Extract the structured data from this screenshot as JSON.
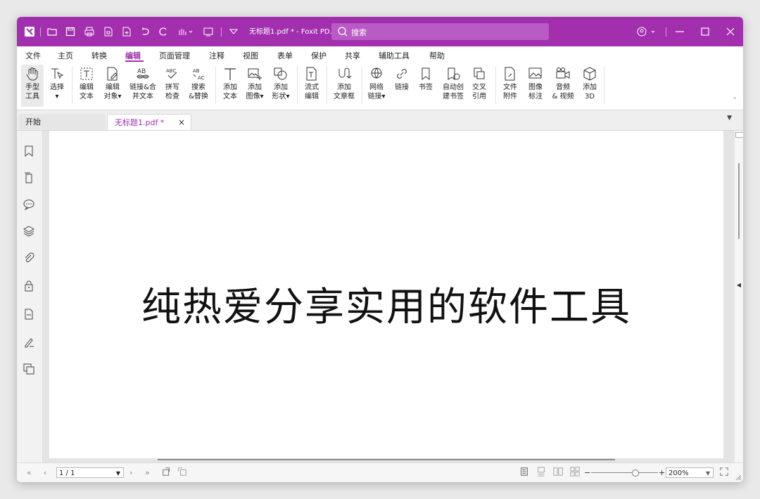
{
  "titlebar": {
    "doc_title": "无标题1.pdf * - Foxit PD...",
    "search_placeholder": "搜索"
  },
  "menu": [
    "文件",
    "主页",
    "转换",
    "编辑",
    "页面管理",
    "注释",
    "视图",
    "表单",
    "保护",
    "共享",
    "辅助工具",
    "帮助"
  ],
  "active_menu": "编辑",
  "ribbon": {
    "hand_tool": "手型\n工具",
    "select": "选择\n▾",
    "edit_text": "编辑\n文本",
    "edit_object": "编辑\n对象▾",
    "link_merge": "链接&合\n并文本",
    "spell_check": "拼写\n检查",
    "search_replace": "搜索\n&替换",
    "add_text": "添加\n文本",
    "add_image": "添加\n图像▾",
    "add_shape": "添加\n形状▾",
    "flow_edit": "流式\n编辑",
    "add_textbox": "添加\n文章框",
    "web_link": "网络\n链接▾",
    "link": "链接",
    "bookmark": "书签",
    "auto_bookmark": "自动创\n建书签",
    "cross_ref": "交叉\n引用",
    "file_attach": "文件\n附件",
    "image_annot": "图像\n标注",
    "audio_video": "音频\n& 视频",
    "add_3d": "添加\n3D"
  },
  "tabs": {
    "home": "开始",
    "doc": "无标题1.pdf *"
  },
  "document": {
    "text": "纯热爱分享实用的软件工具"
  },
  "status": {
    "page": "1 / 1",
    "zoom": "200%"
  },
  "colors": {
    "accent": "#a12fae"
  }
}
